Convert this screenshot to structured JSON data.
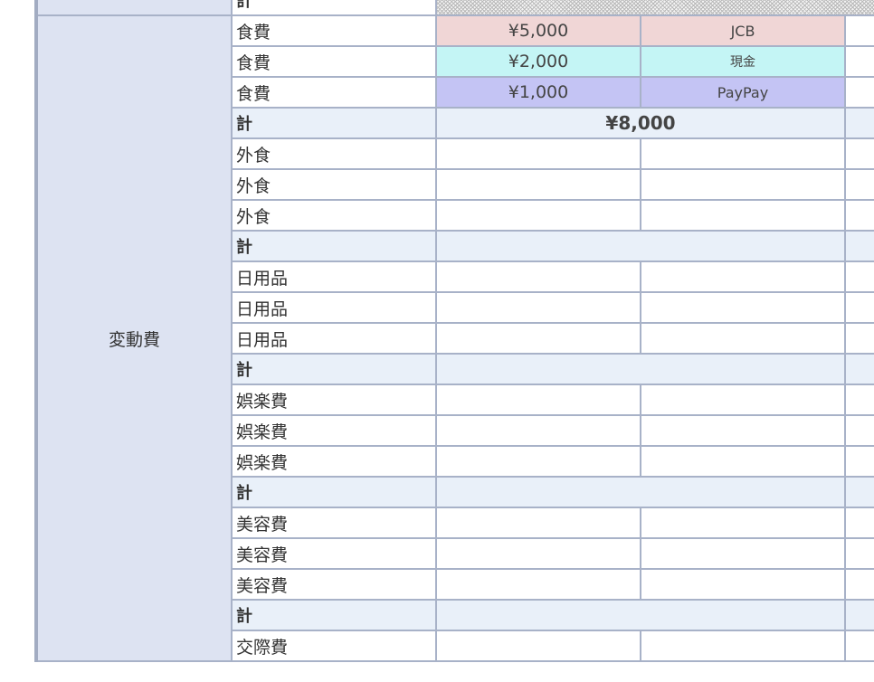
{
  "top_row": {
    "label": "計"
  },
  "group": {
    "label": "変動費"
  },
  "rows": [
    {
      "label": "食費",
      "amount": "¥5,000",
      "method": "JCB",
      "bg": "#f0d6d6",
      "latin": true
    },
    {
      "label": "食費",
      "amount": "¥2,000",
      "method": "現金",
      "bg": "#c4f5f5",
      "latin": false
    },
    {
      "label": "食費",
      "amount": "¥1,000",
      "method": "PayPay",
      "bg": "#c4c4f4",
      "latin": true
    },
    {
      "label": "計",
      "total": "¥8,000",
      "is_total": true
    },
    {
      "label": "外食",
      "amount": "",
      "method": ""
    },
    {
      "label": "外食",
      "amount": "",
      "method": ""
    },
    {
      "label": "外食",
      "amount": "",
      "method": ""
    },
    {
      "label": "計",
      "total": "",
      "is_total": true
    },
    {
      "label": "日用品",
      "amount": "",
      "method": ""
    },
    {
      "label": "日用品",
      "amount": "",
      "method": ""
    },
    {
      "label": "日用品",
      "amount": "",
      "method": ""
    },
    {
      "label": "計",
      "total": "",
      "is_total": true
    },
    {
      "label": "娯楽費",
      "amount": "",
      "method": ""
    },
    {
      "label": "娯楽費",
      "amount": "",
      "method": ""
    },
    {
      "label": "娯楽費",
      "amount": "",
      "method": ""
    },
    {
      "label": "計",
      "total": "",
      "is_total": true
    },
    {
      "label": "美容費",
      "amount": "",
      "method": ""
    },
    {
      "label": "美容費",
      "amount": "",
      "method": ""
    },
    {
      "label": "美容費",
      "amount": "",
      "method": ""
    },
    {
      "label": "計",
      "total": "",
      "is_total": true
    },
    {
      "label": "交際費",
      "amount": "",
      "method": ""
    }
  ]
}
